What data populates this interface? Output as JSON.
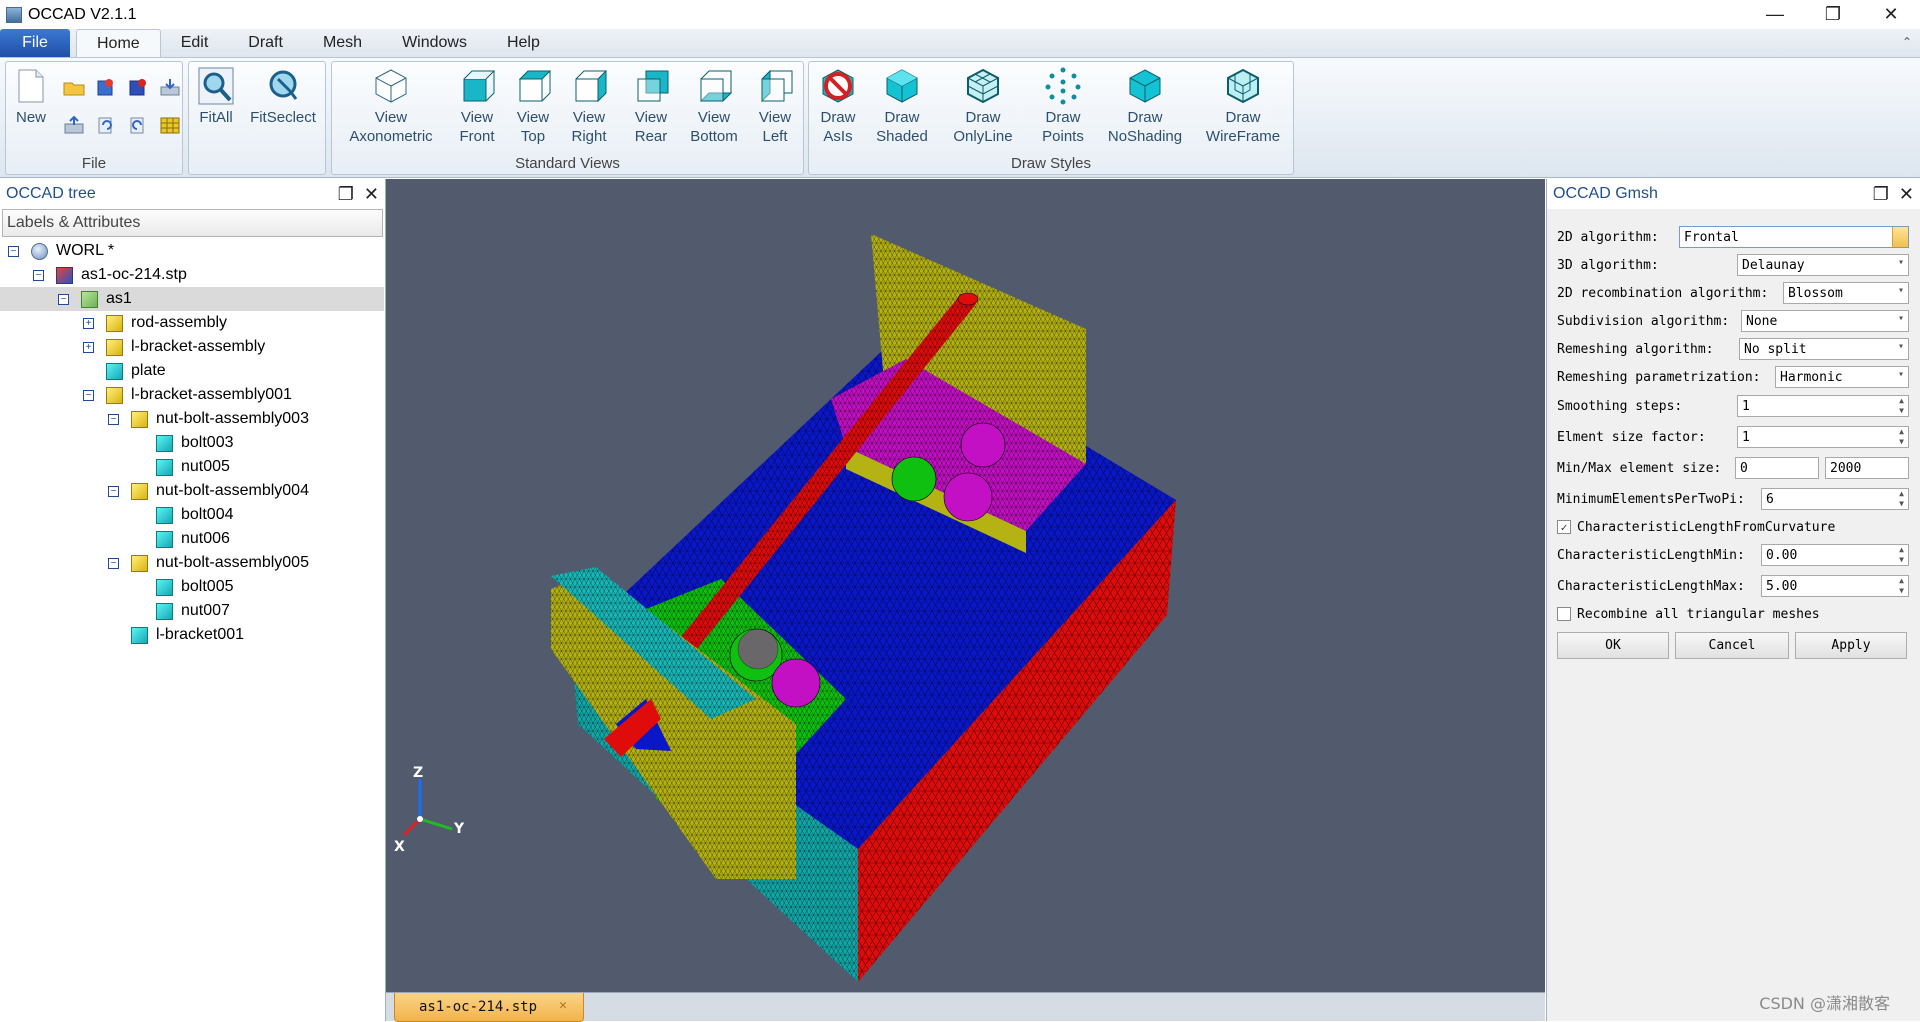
{
  "window": {
    "title": "OCCAD V2.1.1",
    "controls": {
      "minimize": "—",
      "restore": "❐",
      "close": "✕"
    }
  },
  "menu": {
    "file": "File",
    "tabs": [
      "Home",
      "Edit",
      "Draft",
      "Mesh",
      "Windows",
      "Help"
    ],
    "active_tab": "Home"
  },
  "ribbon": {
    "file_group": {
      "label": "File",
      "new_label": "New"
    },
    "fit_group": {
      "fitall": "FitAll",
      "fitselect": "FitSeclect"
    },
    "standard_views": {
      "label": "Standard Views",
      "axonometric": "View\nAxonometric",
      "front": "View\nFront",
      "top": "View\nTop",
      "right": "View\nRight",
      "rear": "View\nRear",
      "bottom": "View\nBottom",
      "left": "View\nLeft"
    },
    "draw_styles": {
      "label": "Draw Styles",
      "asis": "Draw\nAsIs",
      "shaded": "Draw\nShaded",
      "onlyline": "Draw\nOnlyLine",
      "points": "Draw\nPoints",
      "noshading": "Draw\nNoShading",
      "wireframe": "Draw\nWireFrame"
    }
  },
  "tree_panel": {
    "title": "OCCAD tree",
    "column": "Labels & Attributes",
    "nodes": [
      {
        "label": "WORL *",
        "indent": 0,
        "toggle": "−",
        "icon": "globe"
      },
      {
        "label": "as1-oc-214.stp",
        "indent": 1,
        "toggle": "−",
        "icon": "file"
      },
      {
        "label": "as1",
        "indent": 2,
        "toggle": "−",
        "icon": "asm-g",
        "selected": true
      },
      {
        "label": "rod-assembly",
        "indent": 3,
        "toggle": "+",
        "icon": "asm"
      },
      {
        "label": "l-bracket-assembly",
        "indent": 3,
        "toggle": "+",
        "icon": "asm"
      },
      {
        "label": "plate",
        "indent": 3,
        "toggle": "",
        "icon": "cube"
      },
      {
        "label": "l-bracket-assembly001",
        "indent": 3,
        "toggle": "−",
        "icon": "asm"
      },
      {
        "label": "nut-bolt-assembly003",
        "indent": 4,
        "toggle": "−",
        "icon": "asm"
      },
      {
        "label": "bolt003",
        "indent": 5,
        "toggle": "",
        "icon": "cube"
      },
      {
        "label": "nut005",
        "indent": 5,
        "toggle": "",
        "icon": "cube"
      },
      {
        "label": "nut-bolt-assembly004",
        "indent": 4,
        "toggle": "−",
        "icon": "asm"
      },
      {
        "label": "bolt004",
        "indent": 5,
        "toggle": "",
        "icon": "cube"
      },
      {
        "label": "nut006",
        "indent": 5,
        "toggle": "",
        "icon": "cube"
      },
      {
        "label": "nut-bolt-assembly005",
        "indent": 4,
        "toggle": "−",
        "icon": "asm"
      },
      {
        "label": "bolt005",
        "indent": 5,
        "toggle": "",
        "icon": "cube"
      },
      {
        "label": "nut007",
        "indent": 5,
        "toggle": "",
        "icon": "cube"
      },
      {
        "label": "l-bracket001",
        "indent": 4,
        "toggle": "",
        "icon": "cube"
      }
    ]
  },
  "viewport": {
    "axes": {
      "z": "Z",
      "y": "Y",
      "x": "X"
    },
    "colors": {
      "background": "#525a6e",
      "plate": "#0a17c8",
      "side": "#e00c0c",
      "bracket": "#b5b214",
      "base": "#10c010",
      "top": "#c410c4",
      "bracket_cap": "#18b8b8",
      "rod": "#e00c0c"
    }
  },
  "doc_tab": {
    "label": "as1-oc-214.stp",
    "close": "✕"
  },
  "gmsh_panel": {
    "title": "OCCAD Gmsh",
    "fields": {
      "alg2d": {
        "label": "2D algorithm:",
        "value": "Frontal"
      },
      "alg3d": {
        "label": "3D algorithm:",
        "value": "Delaunay"
      },
      "recomb2d": {
        "label": "2D recombination algorithm:",
        "value": "Blossom"
      },
      "subdiv": {
        "label": "Subdivision algorithm:",
        "value": "None"
      },
      "remesh": {
        "label": "Remeshing algorithm:",
        "value": "No split"
      },
      "remesh_param": {
        "label": "Remeshing parametrization:",
        "value": "Harmonic"
      },
      "smoothing": {
        "label": "Smoothing steps:",
        "value": "1"
      },
      "size_factor": {
        "label": "Elment size factor:",
        "value": "1"
      },
      "minmax": {
        "label": "Min/Max element size:",
        "min": "0",
        "max": "2000"
      },
      "min_per_2pi": {
        "label": "MinimumElementsPerTwoPi:",
        "value": "6"
      },
      "char_from_curv": {
        "label": "CharacteristicLengthFromCurvature",
        "checked": "✓"
      },
      "char_min": {
        "label": "CharacteristicLengthMin:",
        "value": "0.00"
      },
      "char_max": {
        "label": "CharacteristicLengthMax:",
        "value": "5.00"
      },
      "recombine_all": {
        "label": "Recombine all triangular meshes"
      }
    },
    "buttons": {
      "ok": "OK",
      "cancel": "Cancel",
      "apply": "Apply"
    }
  },
  "watermark": "CSDN @潇湘散客"
}
